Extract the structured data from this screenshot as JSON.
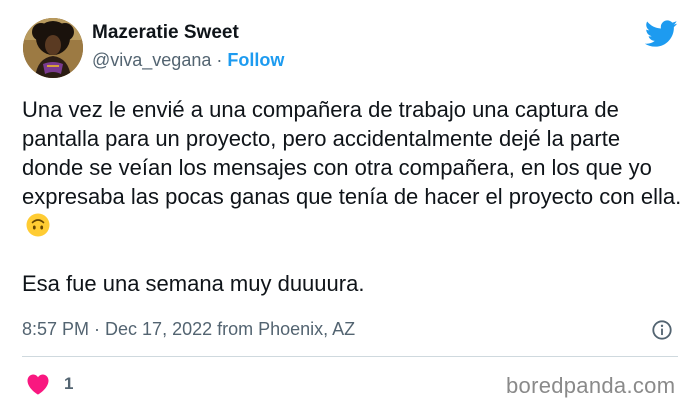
{
  "author": {
    "display_name": "Mazeratie Sweet",
    "handle": "@viva_vegana",
    "separator": "·",
    "follow_label": "Follow"
  },
  "tweet": {
    "text_line_1": "Una vez le envié a una compañera de trabajo una captura de pantalla para un proyecto, pero accidentalmente dejé la parte donde se veían los mensajes con otra compañera, en los que yo expresaba las pocas ganas que tenía de hacer el proyecto con ella.",
    "emoji": "upside-down-face-icon",
    "text_line_2": "Esa fue una semana muy duuuura."
  },
  "meta": {
    "timestamp": "8:57 PM · Dec 17, 2022 from Phoenix, AZ"
  },
  "actions": {
    "like_count": "1"
  },
  "watermark": "boredpanda.com",
  "colors": {
    "accent": "#1d9bf0",
    "like": "#f91880",
    "text": "#0f1419",
    "secondary": "#536471"
  }
}
